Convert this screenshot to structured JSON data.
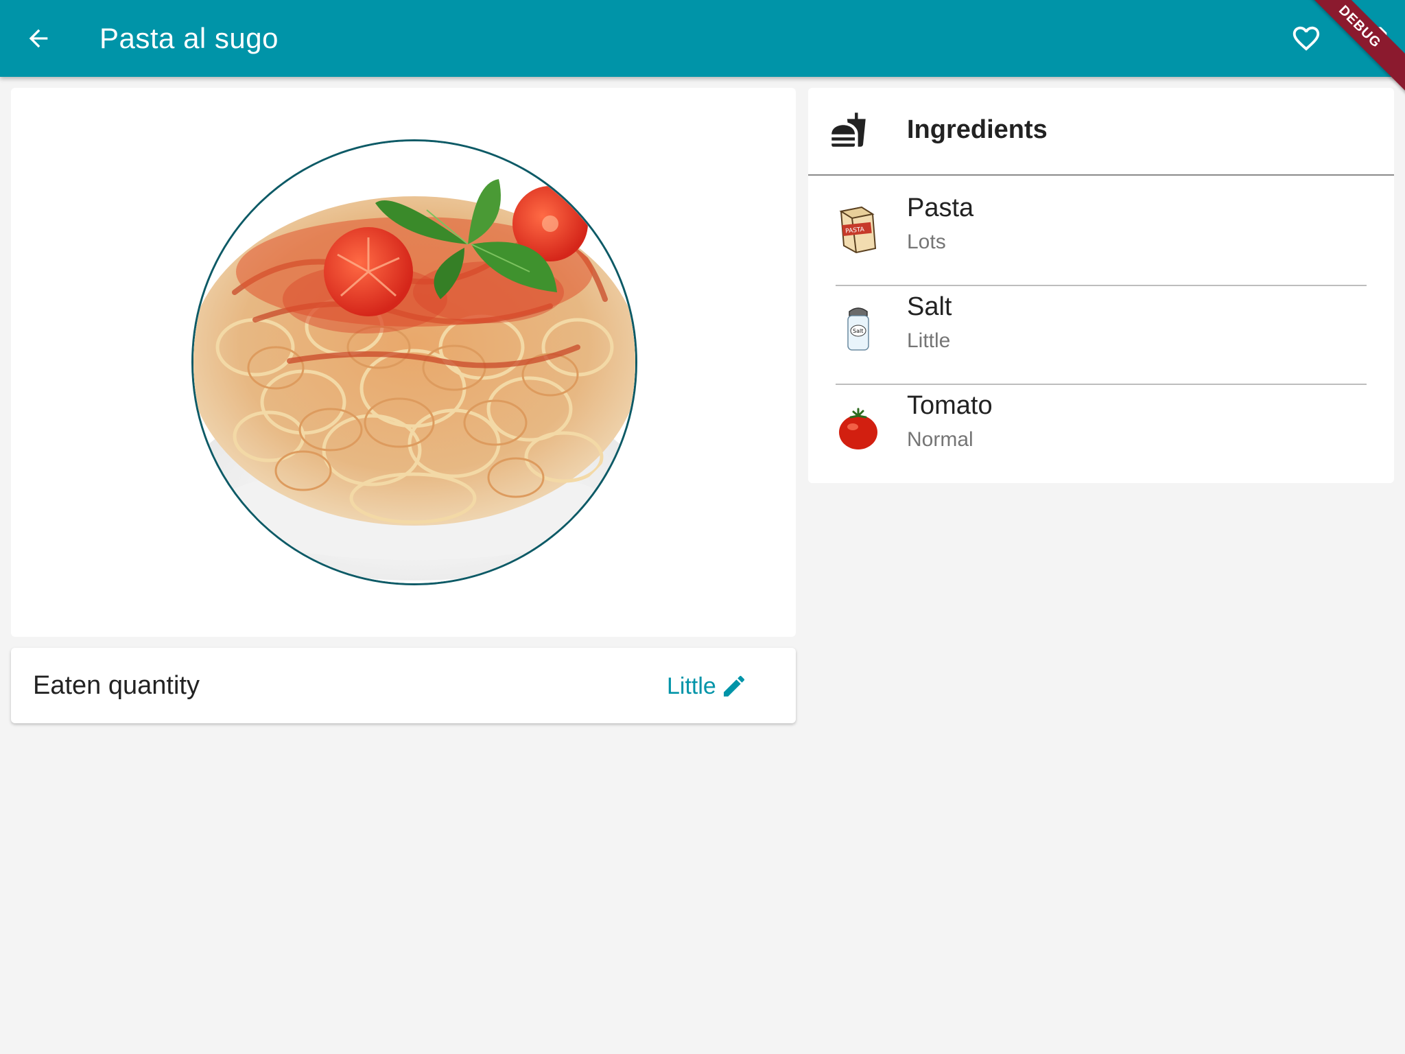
{
  "appbar": {
    "title": "Pasta al sugo",
    "background": "#0094a8",
    "back_icon": "arrow-back-icon",
    "favorite_icon": "heart-outline-icon"
  },
  "debug_banner": {
    "label": "DEBUG"
  },
  "dish": {
    "image": "pasta-with-tomato-sauce-photo"
  },
  "eaten": {
    "label": "Eaten quantity",
    "value": "Little",
    "edit_icon": "pencil-icon",
    "accent": "#0094a8"
  },
  "ingredients": {
    "header_icon": "fastfood-icon",
    "title": "Ingredients",
    "items": [
      {
        "name": "Pasta",
        "quantity": "Lots",
        "icon": "pasta-bag-icon"
      },
      {
        "name": "Salt",
        "quantity": "Little",
        "icon": "salt-shaker-icon"
      },
      {
        "name": "Tomato",
        "quantity": "Normal",
        "icon": "tomato-icon"
      }
    ]
  }
}
